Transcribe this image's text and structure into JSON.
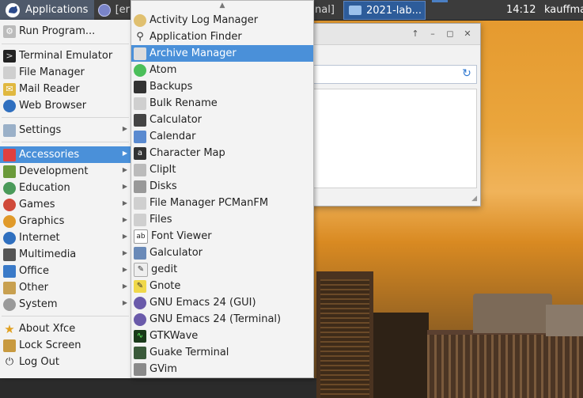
{
  "panel": {
    "applications_label": "Applications",
    "left_task_label": "[er",
    "mid_task_label": "nal]",
    "active_task_label": "2021-lab...",
    "clock": "14:12",
    "user": "kauffma"
  },
  "main_menu": {
    "items": [
      {
        "label": "Run Program...",
        "icon": "run-icon",
        "submenu": false
      },
      {
        "label": "Terminal Emulator",
        "icon": "terminal-icon",
        "submenu": false
      },
      {
        "label": "File Manager",
        "icon": "folder-icon",
        "submenu": false
      },
      {
        "label": "Mail Reader",
        "icon": "mail-icon",
        "submenu": false
      },
      {
        "label": "Web Browser",
        "icon": "globe-icon",
        "submenu": false
      },
      {
        "label": "Settings",
        "icon": "settings-icon",
        "submenu": true
      },
      {
        "label": "Accessories",
        "icon": "accessories-icon",
        "submenu": true,
        "selected": true
      },
      {
        "label": "Development",
        "icon": "development-icon",
        "submenu": true
      },
      {
        "label": "Education",
        "icon": "education-icon",
        "submenu": true
      },
      {
        "label": "Games",
        "icon": "games-icon",
        "submenu": true
      },
      {
        "label": "Graphics",
        "icon": "graphics-icon",
        "submenu": true
      },
      {
        "label": "Internet",
        "icon": "internet-icon",
        "submenu": true
      },
      {
        "label": "Multimedia",
        "icon": "multimedia-icon",
        "submenu": true
      },
      {
        "label": "Office",
        "icon": "office-icon",
        "submenu": true
      },
      {
        "label": "Other",
        "icon": "other-icon",
        "submenu": true
      },
      {
        "label": "System",
        "icon": "system-icon",
        "submenu": true
      },
      {
        "label": "About Xfce",
        "icon": "star-icon",
        "submenu": false
      },
      {
        "label": "Lock Screen",
        "icon": "lock-icon",
        "submenu": false
      },
      {
        "label": "Log Out",
        "icon": "power-icon",
        "submenu": false
      }
    ]
  },
  "accessories_menu": {
    "items": [
      {
        "label": "Activity Log Manager",
        "icon": "activity-log-icon"
      },
      {
        "label": "Application Finder",
        "icon": "magnifier-icon"
      },
      {
        "label": "Archive Manager",
        "icon": "archive-icon",
        "selected": true
      },
      {
        "label": "Atom",
        "icon": "atom-icon"
      },
      {
        "label": "Backups",
        "icon": "backups-icon"
      },
      {
        "label": "Bulk Rename",
        "icon": "bulk-rename-icon"
      },
      {
        "label": "Calculator",
        "icon": "calculator-icon"
      },
      {
        "label": "Calendar",
        "icon": "calendar-icon"
      },
      {
        "label": "Character Map",
        "icon": "character-map-icon"
      },
      {
        "label": "ClipIt",
        "icon": "clipit-icon"
      },
      {
        "label": "Disks",
        "icon": "disks-icon"
      },
      {
        "label": "File Manager PCManFM",
        "icon": "folder-icon"
      },
      {
        "label": "Files",
        "icon": "files-icon"
      },
      {
        "label": "Font Viewer",
        "icon": "font-viewer-icon"
      },
      {
        "label": "Galculator",
        "icon": "galculator-icon"
      },
      {
        "label": "gedit",
        "icon": "gedit-icon"
      },
      {
        "label": "Gnote",
        "icon": "gnote-icon"
      },
      {
        "label": "GNU Emacs 24 (GUI)",
        "icon": "emacs-icon"
      },
      {
        "label": "GNU Emacs 24 (Terminal)",
        "icon": "emacs-icon"
      },
      {
        "label": "GTKWave",
        "icon": "gtkwave-icon"
      },
      {
        "label": "Guake Terminal",
        "icon": "guake-icon"
      },
      {
        "label": "GVim",
        "icon": "gvim-icon"
      }
    ]
  },
  "colors": {
    "selection": "#4a90d9",
    "panel": "#3c3c3c",
    "menu_bg": "#f3f3f3"
  }
}
